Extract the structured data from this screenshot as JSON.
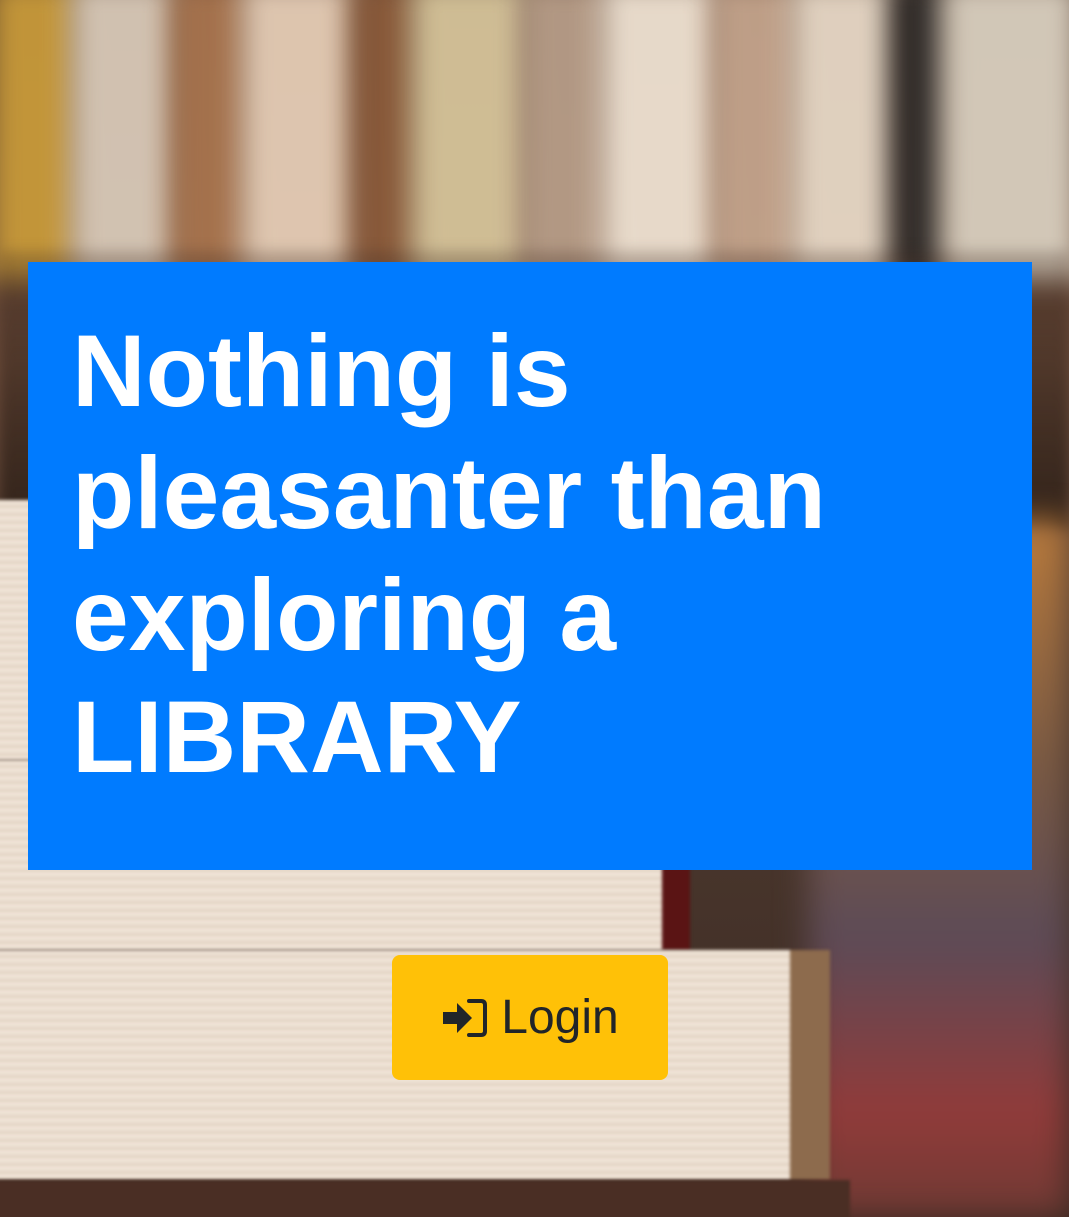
{
  "hero": {
    "title": "Nothing is pleasanter than exploring a LIBRARY"
  },
  "login_button": {
    "label": "Login",
    "icon": "sign-in-icon"
  },
  "colors": {
    "hero_background": "#007bff",
    "hero_text": "#ffffff",
    "button_background": "#ffc107",
    "button_text": "#212529"
  },
  "background": {
    "description_icon": "library-books-photo"
  }
}
